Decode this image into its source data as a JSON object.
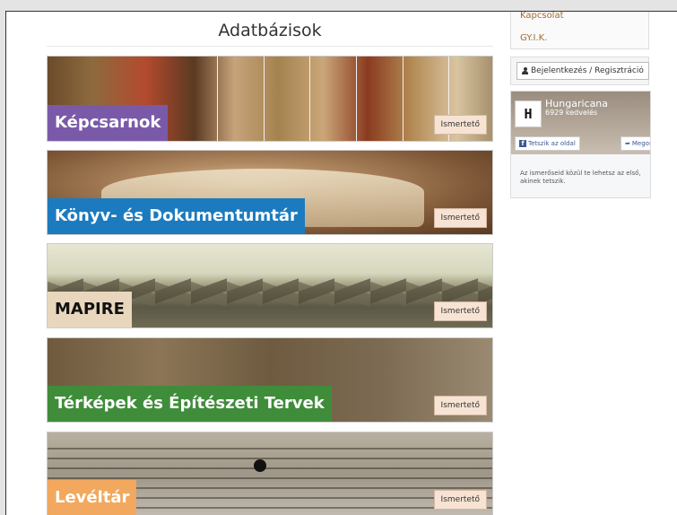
{
  "page": {
    "title": "Adatbázisok"
  },
  "sidebar": {
    "links": [
      {
        "label": "Kapcsolat"
      },
      {
        "label": "GY.I.K."
      }
    ],
    "login_label": "Bejelentkezés / Regisztráció"
  },
  "facebook": {
    "page_name": "Hungaricana",
    "likes": "6929 kedvelés",
    "like_label": "Tetszik az oldal",
    "share_label": "Megosztás",
    "info_text": "Az ismerőseid közül te lehetsz az első, akinek tetszik.",
    "logo_text": "H"
  },
  "databases": [
    {
      "label": "Képcsarnok",
      "button": "Ismertető",
      "color": "#7a5aa8"
    },
    {
      "label": "Könyv- és Dokumentumtár",
      "button": "Ismertető",
      "color": "#1c7bbf"
    },
    {
      "label": "MAPIRE",
      "button": "Ismertető",
      "color": "#e8d7bc"
    },
    {
      "label": "Térképek és Építészeti Tervek",
      "button": "Ismertető",
      "color": "#3f8d3a"
    },
    {
      "label": "Levéltár",
      "button": "Ismertető",
      "color": "#f2a85e"
    }
  ]
}
